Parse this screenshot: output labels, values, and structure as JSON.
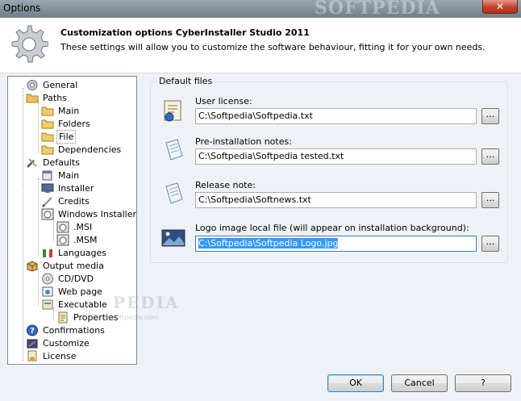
{
  "window": {
    "title": "Options",
    "watermark": "SOFTPEDIA",
    "close_label": "✕"
  },
  "header": {
    "title": "Customization options CyberInstaller Studio 2011",
    "subtitle": "These settings will allow you to customize the software behaviour, fitting it for your own needs."
  },
  "tree": {
    "items": [
      {
        "label": "General",
        "icon": "gear-icon",
        "level": 1
      },
      {
        "label": "Paths",
        "icon": "folder-open-icon",
        "level": 1
      },
      {
        "label": "Main",
        "icon": "folder-icon",
        "level": 2
      },
      {
        "label": "Folders",
        "icon": "folder-icon",
        "level": 2
      },
      {
        "label": "File",
        "icon": "folder-icon",
        "level": 2,
        "selected": true
      },
      {
        "label": "Dependencies",
        "icon": "folder-icon",
        "level": 2
      },
      {
        "label": "Defaults",
        "icon": "tools-icon",
        "level": 1
      },
      {
        "label": "Main",
        "icon": "window-icon",
        "level": 2
      },
      {
        "label": "Installer",
        "icon": "monitor-icon",
        "level": 2
      },
      {
        "label": "Credits",
        "icon": "pen-icon",
        "level": 2
      },
      {
        "label": "Windows Installer",
        "icon": "package-icon",
        "level": 2
      },
      {
        "label": ".MSI",
        "icon": "package-icon",
        "level": 3
      },
      {
        "label": ".MSM",
        "icon": "package-icon",
        "level": 3
      },
      {
        "label": "Languages",
        "icon": "flag-icon",
        "level": 2
      },
      {
        "label": "Output media",
        "icon": "box-icon",
        "level": 1
      },
      {
        "label": "CD/DVD",
        "icon": "cd-icon",
        "level": 2
      },
      {
        "label": "Web page",
        "icon": "webpage-icon",
        "level": 2
      },
      {
        "label": "Executable",
        "icon": "executable-icon",
        "level": 2
      },
      {
        "label": "Properties",
        "icon": "properties-icon",
        "level": 3
      },
      {
        "label": "Confirmations",
        "icon": "help-icon",
        "level": 1
      },
      {
        "label": "Customize",
        "icon": "customize-icon",
        "level": 1
      },
      {
        "label": "License",
        "icon": "license-icon",
        "level": 1
      }
    ],
    "watermark": "PEDIA",
    "watermark_small": "www.softpedia.com"
  },
  "default_files": {
    "group_label": "Default files",
    "fields": [
      {
        "label": "User license:",
        "value": "C:\\Softpedia\\Softpedia.txt",
        "icon": "certificate-icon"
      },
      {
        "label": "Pre-installation notes:",
        "value": "C:\\Softpedia\\Softpedia tested.txt",
        "icon": "notepad-icon"
      },
      {
        "label": "Release note:",
        "value": "C:\\Softpedia\\Softnews.txt",
        "icon": "notepad-icon"
      },
      {
        "label": "Logo image local file (will appear on installation background):",
        "value": "C:\\Softpedia\\Softpedia Logo.jpg",
        "icon": "image-icon"
      }
    ],
    "browse_label": "..."
  },
  "buttons": {
    "ok": "OK",
    "cancel": "Cancel",
    "help": "?"
  }
}
